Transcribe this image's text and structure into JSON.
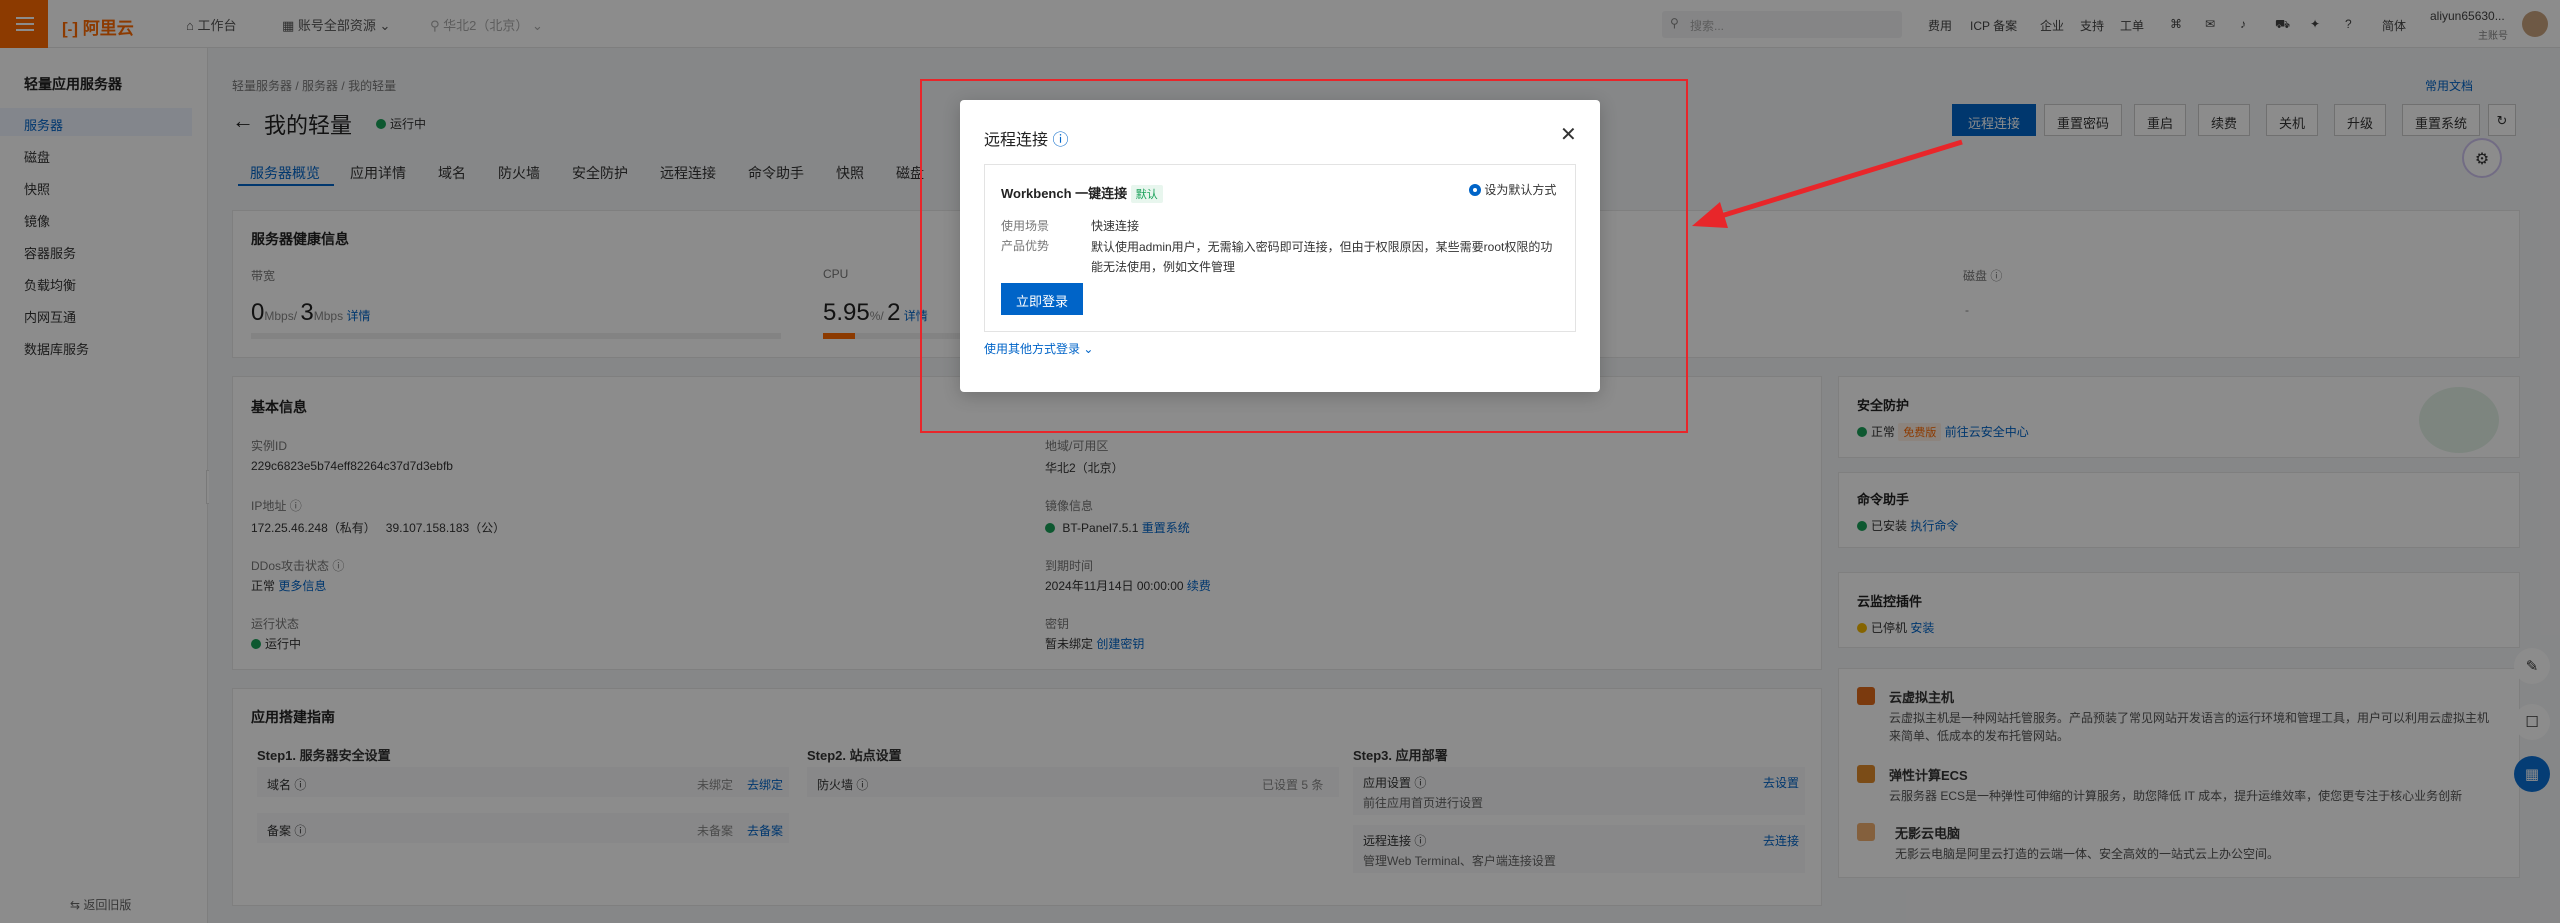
{
  "topbar": {
    "logo": "阿里云",
    "workbench": "工作台",
    "account": "账号全部资源",
    "region": "华北2（北京）",
    "search_placeholder": "搜索...",
    "links": [
      "费用",
      "ICP 备案",
      "企业",
      "支持",
      "工单"
    ],
    "lang": "简体",
    "user": "aliyun65630...",
    "user_role": "主账号"
  },
  "sidebar": {
    "title": "轻量应用服务器",
    "items": [
      "服务器",
      "磁盘",
      "快照",
      "镜像",
      "容器服务",
      "负载均衡",
      "内网互通",
      "数据库服务"
    ],
    "footer": "返回旧版"
  },
  "breadcrumb": [
    "轻量服务器",
    "服务器",
    "我的轻量"
  ],
  "help_doc": "常用文档",
  "page": {
    "title": "我的轻量",
    "status": "运行中"
  },
  "actions": [
    "远程连接",
    "重置密码",
    "重启",
    "续费",
    "关机",
    "升级",
    "重置系统"
  ],
  "tabs": [
    "服务器概览",
    "应用详情",
    "域名",
    "防火墙",
    "安全防护",
    "远程连接",
    "命令助手",
    "快照",
    "磁盘"
  ],
  "health": {
    "title": "服务器健康信息",
    "bandwidth_label": "带宽",
    "bandwidth_val": "0",
    "bandwidth_unit1": "Mbps/",
    "bandwidth_max": "3",
    "bandwidth_unit2": "Mbps",
    "detail": "详情",
    "cpu_label": "CPU",
    "cpu_val": "5.95",
    "cpu_unit": "%/",
    "cpu_cores": "2",
    "cpu_detail": "详情",
    "cpu_fill": 0.06,
    "disk_label": "磁盘",
    "disk_val": "-"
  },
  "basic": {
    "title": "基本信息",
    "instance_id_label": "实例ID",
    "instance_id": "229c6823e5b74eff82264c37d7d3ebfb",
    "region_label": "地域/可用区",
    "region": "华北2（北京）",
    "ip_label": "IP地址",
    "ip_private": "172.25.46.248（私有）",
    "ip_public": "39.107.158.183（公）",
    "image_label": "镜像信息",
    "image": "BT-Panel7.5.1",
    "reset_system": "重置系统",
    "ddos_label": "DDos攻击状态",
    "ddos": "正常",
    "more": "更多信息",
    "expire_label": "到期时间",
    "expire": "2024年11月14日 00:00:00",
    "renew": "续费",
    "run_label": "运行状态",
    "run": "运行中",
    "key_label": "密钥",
    "key": "暂未绑定",
    "create_key": "创建密钥"
  },
  "guide": {
    "title": "应用搭建指南",
    "step1": "Step1. 服务器安全设置",
    "step2": "Step2. 站点设置",
    "step3": "Step3. 应用部署",
    "domain": "域名",
    "domain_status": "未绑定",
    "domain_action": "去绑定",
    "beian": "备案",
    "beian_status": "未备案",
    "beian_action": "去备案",
    "firewall": "防火墙",
    "firewall_status": "已设置 5 条",
    "app_setting": "应用设置",
    "app_setting_desc": "前往应用首页进行设置",
    "app_setting_action": "去设置",
    "remote": "远程连接",
    "remote_desc": "管理Web Terminal、客户端连接设置",
    "remote_action": "去连接"
  },
  "right_panel": {
    "security_title": "安全防护",
    "security_status": "正常",
    "security_tag": "免费版",
    "security_link": "前往云安全中心",
    "cmd_title": "命令助手",
    "cmd_status": "已安装",
    "cmd_link": "执行命令",
    "monitor_title": "云监控插件",
    "monitor_status": "已停机",
    "monitor_link": "安装",
    "products": [
      {
        "name": "云虚拟主机",
        "desc": "云虚拟主机是一种网站托管服务。产品预装了常见网站开发语言的运行环境和管理工具，用户可以利用云虚拟主机来简单、低成本的发布托管网站。"
      },
      {
        "name": "弹性计算ECS",
        "desc": "云服务器 ECS是一种弹性可伸缩的计算服务，助您降低 IT 成本，提升运维效率，使您更专注于核心业务创新"
      },
      {
        "name": "无影云电脑",
        "desc": "无影云电脑是阿里云打造的云端一体、安全高效的一站式云上办公空间。"
      }
    ]
  },
  "modal": {
    "title": "远程连接",
    "card_title": "Workbench 一键连接",
    "default_tag": "默认",
    "set_default": "设为默认方式",
    "scene_label": "使用场景",
    "scene": "快速连接",
    "adv_label": "产品优势",
    "adv": "默认使用admin用户，无需输入密码即可连接，但由于权限原因，某些需要root权限的功能无法使用，例如文件管理",
    "login_button": "立即登录",
    "other": "使用其他方式登录"
  },
  "colors": {
    "brand": "#ff6a00",
    "primary": "#0064c8",
    "annotation": "#e8262a",
    "success": "#18a058"
  }
}
